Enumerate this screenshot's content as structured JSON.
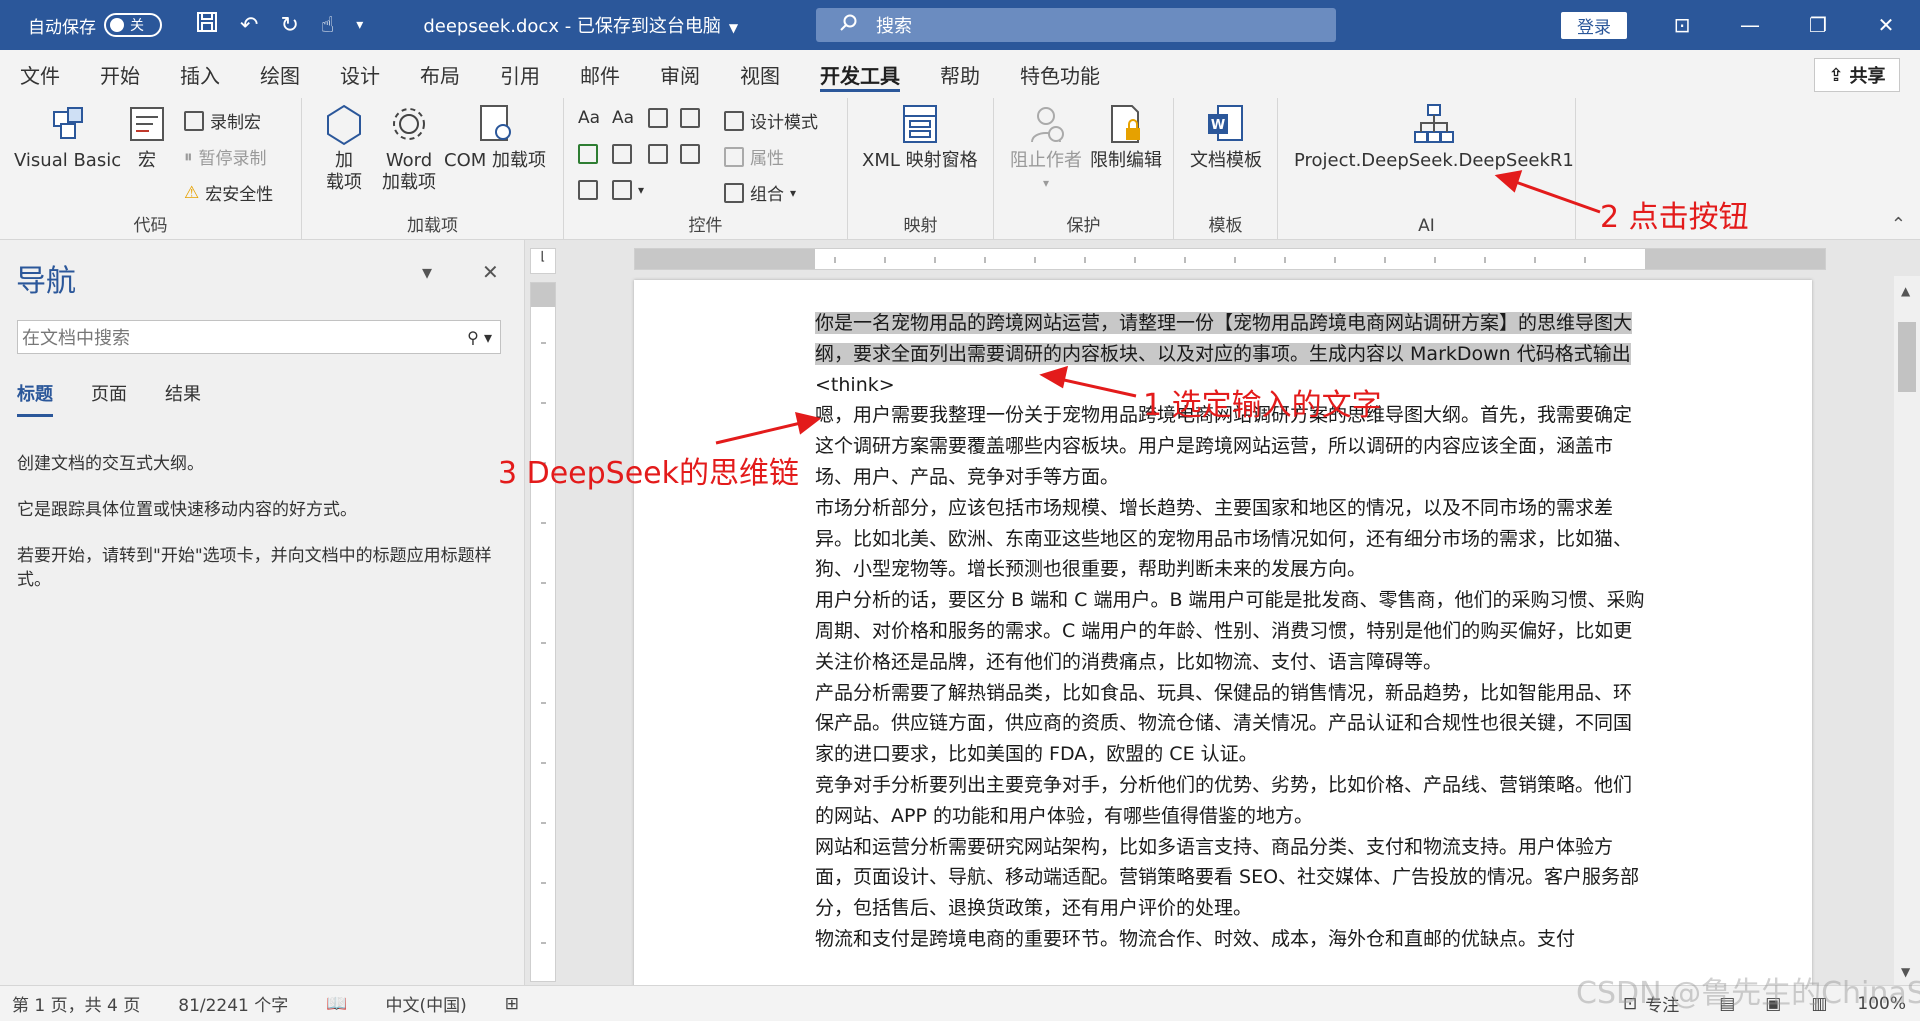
{
  "titlebar": {
    "autosave_label": "自动保存",
    "autosave_state": "关",
    "doc_title": "deepseek.docx - 已保存到这台电脑",
    "search_placeholder": "搜索",
    "login_label": "登录"
  },
  "tabs": [
    "文件",
    "开始",
    "插入",
    "绘图",
    "设计",
    "布局",
    "引用",
    "邮件",
    "审阅",
    "视图",
    "开发工具",
    "帮助",
    "特色功能"
  ],
  "active_tab": "开发工具",
  "share_label": "共享",
  "ribbon": {
    "code": {
      "label": "代码",
      "visual_basic": "Visual Basic",
      "macro": "宏",
      "record_macro": "录制宏",
      "pause_record": "暂停录制",
      "macro_security": "宏安全性"
    },
    "addins": {
      "label": "加载项",
      "add": "加",
      "add2": "载项",
      "word": "Word",
      "word2": "加载项",
      "com": "COM 加载项"
    },
    "controls": {
      "label": "控件",
      "design_mode": "设计模式",
      "properties": "属性",
      "group": "组合"
    },
    "mapping": {
      "label": "映射",
      "xml": "XML 映射窗格"
    },
    "protect": {
      "label": "保护",
      "block_authors": "阻止作者",
      "restrict_editing": "限制编辑"
    },
    "templates": {
      "label": "模板",
      "doc_template": "文档模板"
    },
    "ai": {
      "label": "AI",
      "deepseek_button": "Project.DeepSeek.DeepSeekR1"
    }
  },
  "nav": {
    "title": "导航",
    "search_placeholder": "在文档中搜索",
    "tabs": [
      "标题",
      "页面",
      "结果"
    ],
    "text1": "创建文档的交互式大纲。",
    "text2": "它是跟踪具体位置或快速移动内容的好方式。",
    "text3": "若要开始，请转到\"开始\"选项卡，并向文档中的标题应用标题样式。"
  },
  "document": {
    "selected_prompt": "你是一名宠物用品的跨境网站运营，请整理一份【宠物用品跨境电商网站调研方案】的思维导图大纲，要求全面列出需要调研的内容板块、以及对应的事项。生成内容以 MarkDown 代码格式输出",
    "think_tag": "<think>",
    "paragraphs": [
      "嗯，用户需要我整理一份关于宠物用品跨境电商网站调研方案的思维导图大纲。首先，我需要确定这个调研方案需要覆盖哪些内容板块。用户是跨境网站运营，所以调研的内容应该全面，涵盖市场、用户、产品、竞争对手等方面。",
      "市场分析部分，应该包括市场规模、增长趋势、主要国家和地区的情况，以及不同市场的需求差异。比如北美、欧洲、东南亚这些地区的宠物用品市场情况如何，还有细分市场的需求，比如猫、狗、小型宠物等。增长预测也很重要，帮助判断未来的发展方向。",
      "用户分析的话，要区分 B 端和 C 端用户。B 端用户可能是批发商、零售商，他们的采购习惯、采购周期、对价格和服务的需求。C 端用户的年龄、性别、消费习惯，特别是他们的购买偏好，比如更关注价格还是品牌，还有他们的消费痛点，比如物流、支付、语言障碍等。",
      "产品分析需要了解热销品类，比如食品、玩具、保健品的销售情况，新品趋势，比如智能用品、环保产品。供应链方面，供应商的资质、物流仓储、清关情况。产品认证和合规性也很关键，不同国家的进口要求，比如美国的 FDA，欧盟的 CE 认证。",
      "竞争对手分析要列出主要竞争对手，分析他们的优势、劣势，比如价格、产品线、营销策略。他们的网站、APP 的功能和用户体验，有哪些值得借鉴的地方。",
      "网站和运营分析需要研究网站架构，比如多语言支持、商品分类、支付和物流支持。用户体验方面，页面设计、导航、移动端适配。营销策略要看 SEO、社交媒体、广告投放的情况。客户服务部分，包括售后、退换货政策，还有用户评价的处理。",
      "物流和支付是跨境电商的重要环节。物流合作、时效、成本，海外仓和直邮的优缺点。支付"
    ]
  },
  "annotations": {
    "a1": "1 选定输入的文字",
    "a2": "2 点击按钮",
    "a3": "3 DeepSeek的思维链"
  },
  "status": {
    "page": "第 1 页，共 4 页",
    "words": "81/2241 个字",
    "lang": "中文(中国)",
    "focus": "专注",
    "zoom": "100%"
  },
  "watermark": "CSDN @鲁先生的ChinaSDN",
  "colors": {
    "brand": "#2b579a",
    "annotation": "#e31b1b",
    "selection": "#c8c8c8"
  }
}
